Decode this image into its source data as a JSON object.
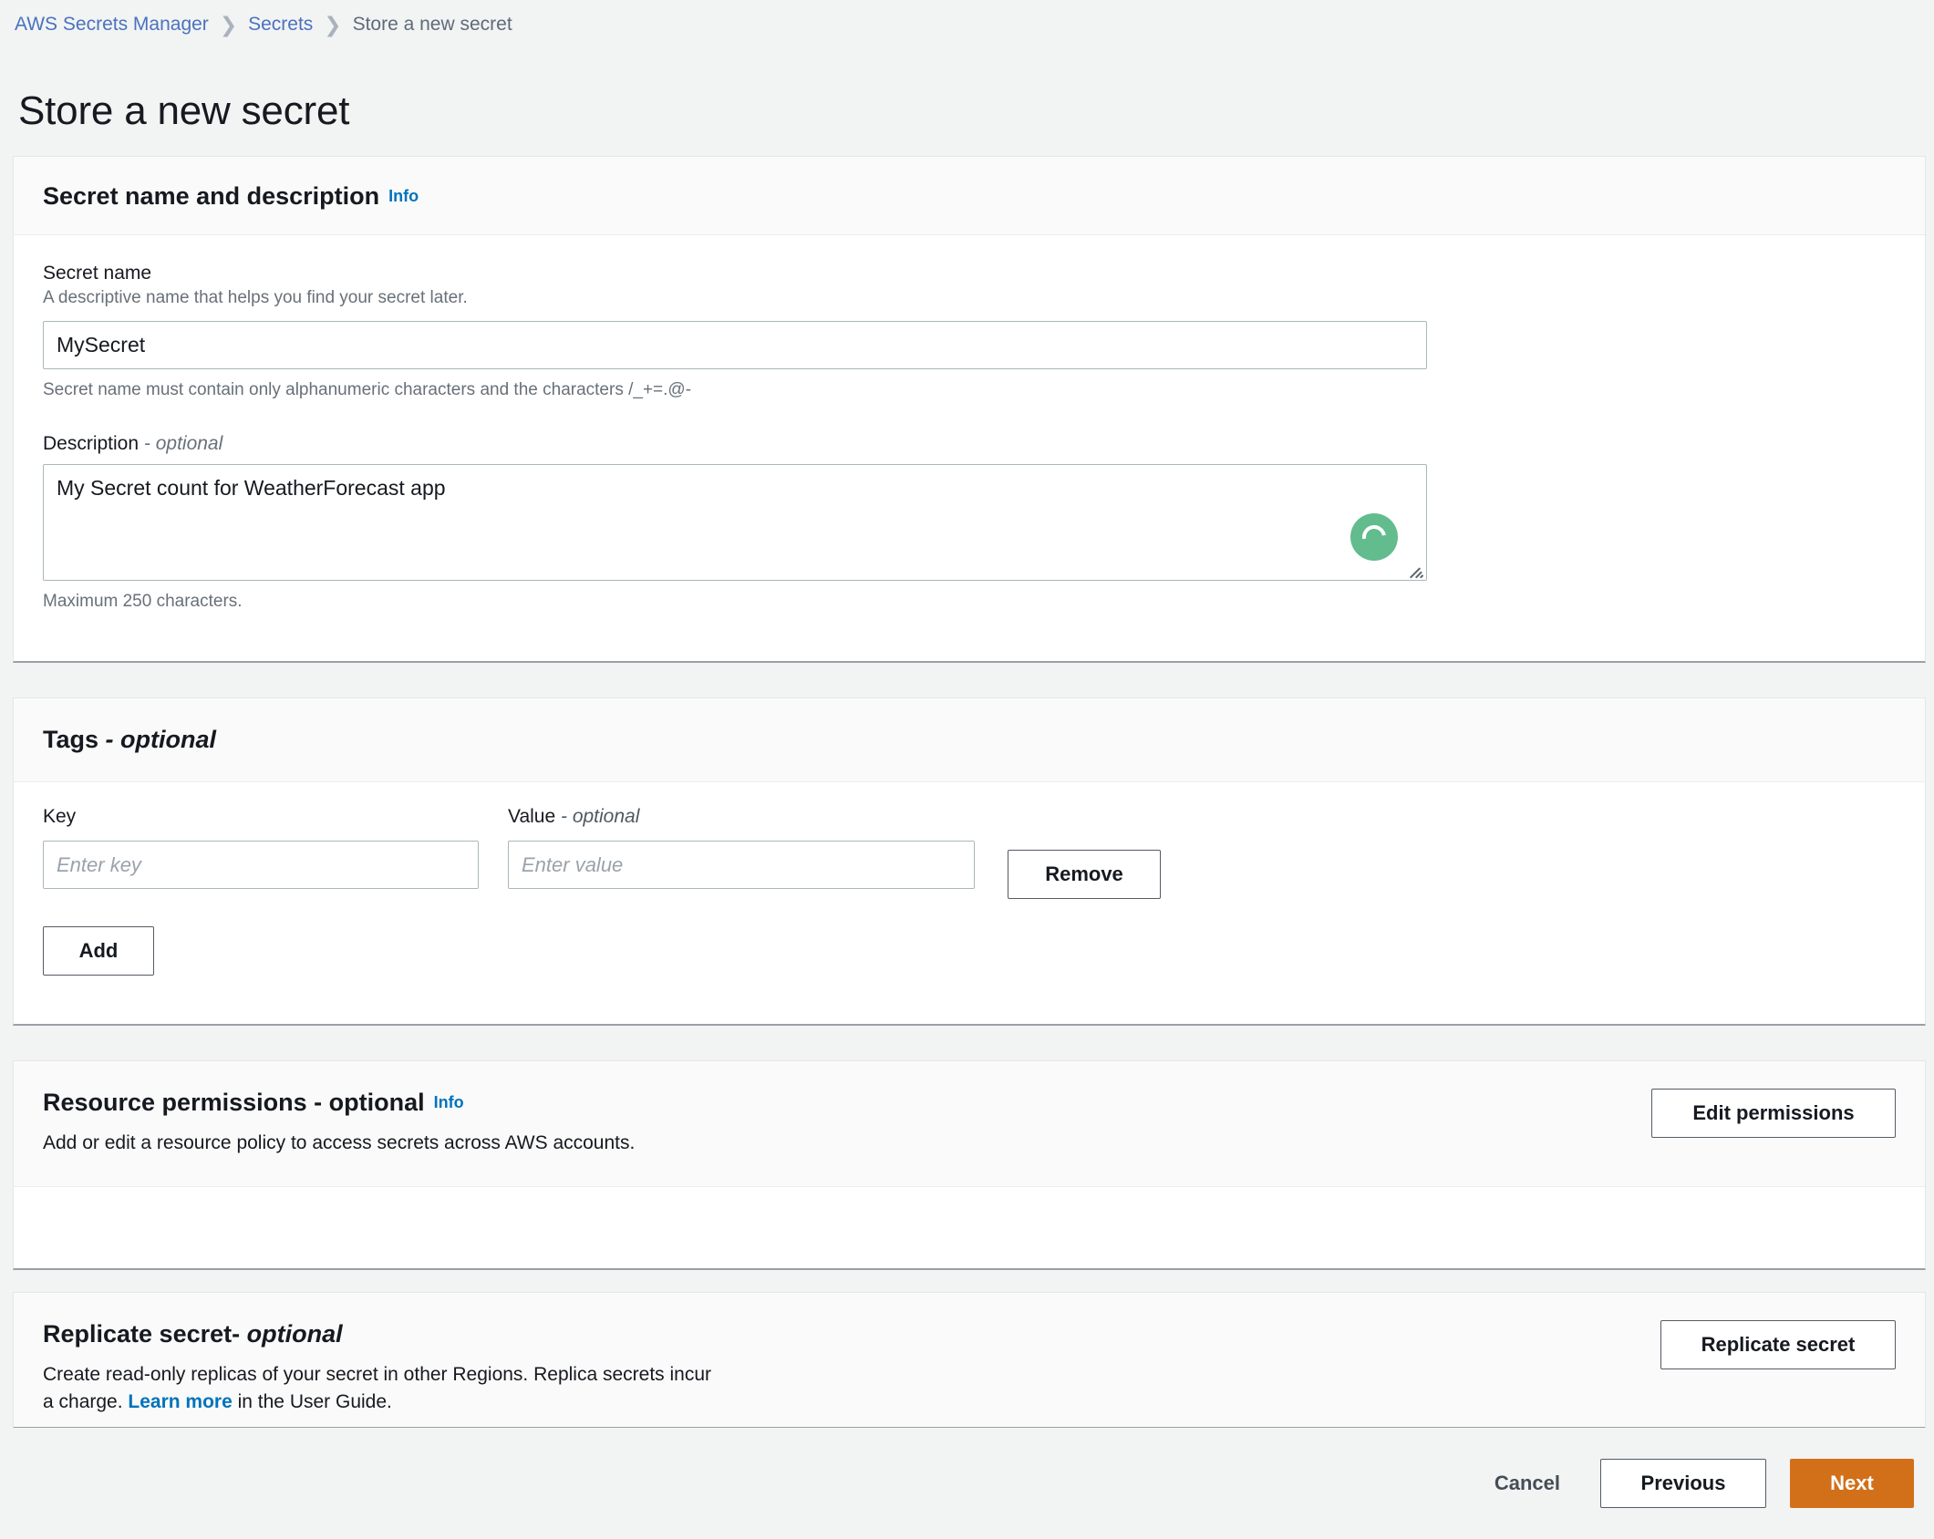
{
  "breadcrumb": {
    "items": [
      {
        "label": "AWS Secrets Manager",
        "current": false
      },
      {
        "label": "Secrets",
        "current": false
      },
      {
        "label": "Store a new secret",
        "current": true
      }
    ],
    "separator": "❯"
  },
  "page": {
    "title": "Store a new secret"
  },
  "secret_section": {
    "heading": "Secret name and description",
    "info_label": "Info",
    "name_label": "Secret name",
    "name_desc": "A descriptive name that helps you find your secret later.",
    "name_value": "MySecret",
    "name_placeholder": "",
    "name_hint": "Secret name must contain only alphanumeric characters and the characters /_+=.@-",
    "description_label": "Description",
    "description_optional": "- optional",
    "description_value": "My Secret count for WeatherForecast app",
    "description_placeholder": "",
    "description_hint": "Maximum 250 characters."
  },
  "tags_section": {
    "heading": "Tags",
    "heading_optional": "- optional",
    "key_header": "Key",
    "value_header": "Value",
    "value_header_optional": "- optional",
    "key_placeholder": "Enter key",
    "key_value": "",
    "value_placeholder": "Enter value",
    "value_value": "",
    "remove_label": "Remove",
    "add_label": "Add"
  },
  "permissions_section": {
    "heading": "Resource permissions - optional",
    "info_label": "Info",
    "description": "Add or edit a resource policy to access secrets across AWS accounts.",
    "edit_button_label": "Edit permissions"
  },
  "replicate_section": {
    "heading": "Replicate secret-",
    "heading_optional": "optional",
    "description_line1": "Create read-only replicas of your secret in other Regions. Replica secrets incur",
    "description_line2_pre": "a charge. ",
    "description_link": "Learn more",
    "description_line2_post": " in the User Guide.",
    "replicate_button_label": "Replicate secret"
  },
  "footer": {
    "cancel_label": "Cancel",
    "previous_label": "Previous",
    "next_label": "Next"
  },
  "cursor": {
    "icon": "loading-spinner-icon"
  },
  "colors": {
    "accent_orange": "#d2701a",
    "link_blue": "#0073bb",
    "breadcrumb_blue": "#4a72bf",
    "cursor_green": "#62bc8e",
    "page_background": "#f2f3f3"
  }
}
